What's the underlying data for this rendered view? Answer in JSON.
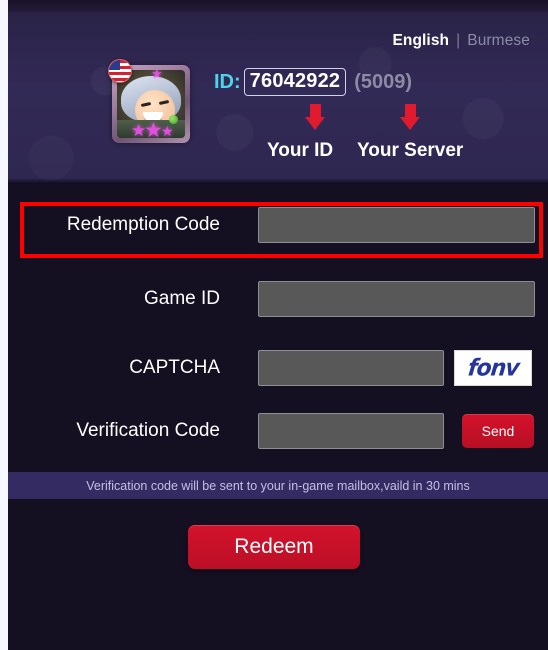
{
  "header": {
    "language": {
      "active_label": "English",
      "separator": "|",
      "inactive_label": "Burmese"
    },
    "account": {
      "id_label": "ID:",
      "id_value": "76042922",
      "server_value": "(5009)"
    },
    "hints": {
      "your_id": "Your ID",
      "your_server": "Your Server"
    },
    "avatar": {
      "flag": "us-flag-badge",
      "star_glyph": "★"
    }
  },
  "form": {
    "rows": [
      {
        "label": "Redemption Code",
        "value": "",
        "placeholder": "",
        "highlighted": true
      },
      {
        "label": "Game ID",
        "value": "",
        "placeholder": "",
        "highlighted": false
      },
      {
        "label": "CAPTCHA",
        "value": "",
        "placeholder": "",
        "highlighted": false
      },
      {
        "label": "Verification Code",
        "value": "",
        "placeholder": "",
        "highlighted": false
      }
    ],
    "captcha_image_text": "fonv",
    "send_label": "Send",
    "highlight_color": "#ff0000"
  },
  "notice": {
    "text": "Verification code will be sent to your in-game mailbox,vaild in 30 mins"
  },
  "actions": {
    "redeem_label": "Redeem"
  },
  "colors": {
    "header_bg": "#322a56",
    "body_bg": "#150f22",
    "notice_bg": "#342b63",
    "accent_red": "#d4122c",
    "id_cyan": "#4fd3e8",
    "field_bg": "#585858"
  }
}
